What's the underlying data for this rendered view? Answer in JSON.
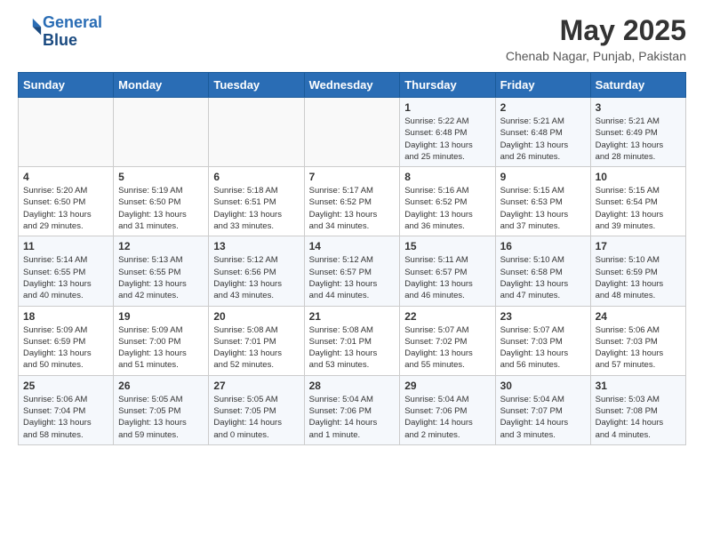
{
  "header": {
    "logo_line1": "General",
    "logo_line2": "Blue",
    "month_year": "May 2025",
    "location": "Chenab Nagar, Punjab, Pakistan"
  },
  "weekdays": [
    "Sunday",
    "Monday",
    "Tuesday",
    "Wednesday",
    "Thursday",
    "Friday",
    "Saturday"
  ],
  "weeks": [
    [
      {
        "day": "",
        "info": ""
      },
      {
        "day": "",
        "info": ""
      },
      {
        "day": "",
        "info": ""
      },
      {
        "day": "",
        "info": ""
      },
      {
        "day": "1",
        "info": "Sunrise: 5:22 AM\nSunset: 6:48 PM\nDaylight: 13 hours\nand 25 minutes."
      },
      {
        "day": "2",
        "info": "Sunrise: 5:21 AM\nSunset: 6:48 PM\nDaylight: 13 hours\nand 26 minutes."
      },
      {
        "day": "3",
        "info": "Sunrise: 5:21 AM\nSunset: 6:49 PM\nDaylight: 13 hours\nand 28 minutes."
      }
    ],
    [
      {
        "day": "4",
        "info": "Sunrise: 5:20 AM\nSunset: 6:50 PM\nDaylight: 13 hours\nand 29 minutes."
      },
      {
        "day": "5",
        "info": "Sunrise: 5:19 AM\nSunset: 6:50 PM\nDaylight: 13 hours\nand 31 minutes."
      },
      {
        "day": "6",
        "info": "Sunrise: 5:18 AM\nSunset: 6:51 PM\nDaylight: 13 hours\nand 33 minutes."
      },
      {
        "day": "7",
        "info": "Sunrise: 5:17 AM\nSunset: 6:52 PM\nDaylight: 13 hours\nand 34 minutes."
      },
      {
        "day": "8",
        "info": "Sunrise: 5:16 AM\nSunset: 6:52 PM\nDaylight: 13 hours\nand 36 minutes."
      },
      {
        "day": "9",
        "info": "Sunrise: 5:15 AM\nSunset: 6:53 PM\nDaylight: 13 hours\nand 37 minutes."
      },
      {
        "day": "10",
        "info": "Sunrise: 5:15 AM\nSunset: 6:54 PM\nDaylight: 13 hours\nand 39 minutes."
      }
    ],
    [
      {
        "day": "11",
        "info": "Sunrise: 5:14 AM\nSunset: 6:55 PM\nDaylight: 13 hours\nand 40 minutes."
      },
      {
        "day": "12",
        "info": "Sunrise: 5:13 AM\nSunset: 6:55 PM\nDaylight: 13 hours\nand 42 minutes."
      },
      {
        "day": "13",
        "info": "Sunrise: 5:12 AM\nSunset: 6:56 PM\nDaylight: 13 hours\nand 43 minutes."
      },
      {
        "day": "14",
        "info": "Sunrise: 5:12 AM\nSunset: 6:57 PM\nDaylight: 13 hours\nand 44 minutes."
      },
      {
        "day": "15",
        "info": "Sunrise: 5:11 AM\nSunset: 6:57 PM\nDaylight: 13 hours\nand 46 minutes."
      },
      {
        "day": "16",
        "info": "Sunrise: 5:10 AM\nSunset: 6:58 PM\nDaylight: 13 hours\nand 47 minutes."
      },
      {
        "day": "17",
        "info": "Sunrise: 5:10 AM\nSunset: 6:59 PM\nDaylight: 13 hours\nand 48 minutes."
      }
    ],
    [
      {
        "day": "18",
        "info": "Sunrise: 5:09 AM\nSunset: 6:59 PM\nDaylight: 13 hours\nand 50 minutes."
      },
      {
        "day": "19",
        "info": "Sunrise: 5:09 AM\nSunset: 7:00 PM\nDaylight: 13 hours\nand 51 minutes."
      },
      {
        "day": "20",
        "info": "Sunrise: 5:08 AM\nSunset: 7:01 PM\nDaylight: 13 hours\nand 52 minutes."
      },
      {
        "day": "21",
        "info": "Sunrise: 5:08 AM\nSunset: 7:01 PM\nDaylight: 13 hours\nand 53 minutes."
      },
      {
        "day": "22",
        "info": "Sunrise: 5:07 AM\nSunset: 7:02 PM\nDaylight: 13 hours\nand 55 minutes."
      },
      {
        "day": "23",
        "info": "Sunrise: 5:07 AM\nSunset: 7:03 PM\nDaylight: 13 hours\nand 56 minutes."
      },
      {
        "day": "24",
        "info": "Sunrise: 5:06 AM\nSunset: 7:03 PM\nDaylight: 13 hours\nand 57 minutes."
      }
    ],
    [
      {
        "day": "25",
        "info": "Sunrise: 5:06 AM\nSunset: 7:04 PM\nDaylight: 13 hours\nand 58 minutes."
      },
      {
        "day": "26",
        "info": "Sunrise: 5:05 AM\nSunset: 7:05 PM\nDaylight: 13 hours\nand 59 minutes."
      },
      {
        "day": "27",
        "info": "Sunrise: 5:05 AM\nSunset: 7:05 PM\nDaylight: 14 hours\nand 0 minutes."
      },
      {
        "day": "28",
        "info": "Sunrise: 5:04 AM\nSunset: 7:06 PM\nDaylight: 14 hours\nand 1 minute."
      },
      {
        "day": "29",
        "info": "Sunrise: 5:04 AM\nSunset: 7:06 PM\nDaylight: 14 hours\nand 2 minutes."
      },
      {
        "day": "30",
        "info": "Sunrise: 5:04 AM\nSunset: 7:07 PM\nDaylight: 14 hours\nand 3 minutes."
      },
      {
        "day": "31",
        "info": "Sunrise: 5:03 AM\nSunset: 7:08 PM\nDaylight: 14 hours\nand 4 minutes."
      }
    ]
  ]
}
